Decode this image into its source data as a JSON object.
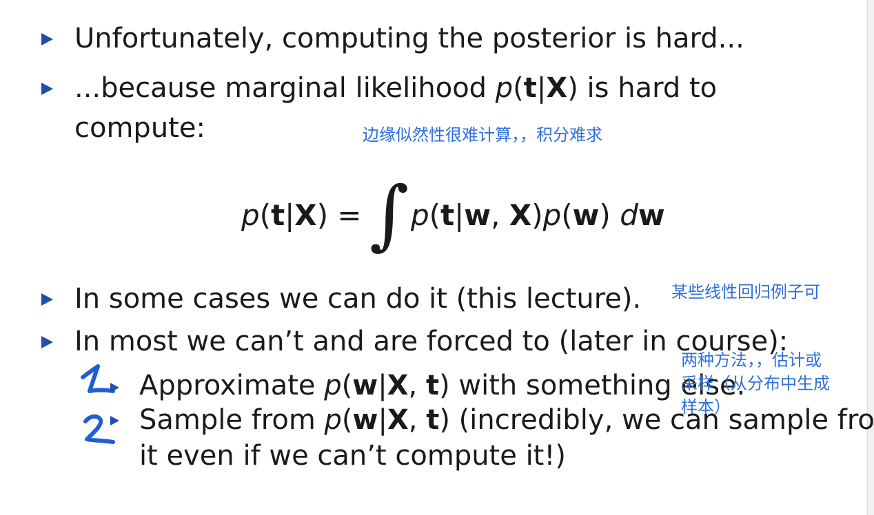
{
  "bullets": {
    "b1": "Unfortunately, computing the posterior is hard...",
    "b2_a": "...because marginal likelihood ",
    "b2_b": " is hard to",
    "b2_c": "compute:",
    "b3": "In some cases we can do it (this lecture).",
    "b4": "In most we can’t and are forced to (later in course):",
    "sub1_a": "Approximate ",
    "sub1_b": " with something else.",
    "sub2_a": "Sample from ",
    "sub2_b": " (incredibly, we can sample from",
    "sub2_c": "it even if we can’t compute it!)"
  },
  "math": {
    "p": "p",
    "t": "t",
    "X": "X",
    "w": "w",
    "d": "d",
    "lparen": "(",
    "rparen": ")",
    "bar": "|",
    "comma": ", ",
    "equals": " = "
  },
  "annotations": {
    "note1": "边缘似然性很难计算，，积分难求",
    "note2": "某些线性回归例子可",
    "note3_l1": "两种方法，，估计或",
    "note3_l2": "采样（从分布中生成",
    "note3_l3": "样本）"
  },
  "colors": {
    "bullet": "#1f4fa8",
    "annotation": "#2f6fdb",
    "handwriting": "#1e5fd6"
  },
  "icons": {
    "bullet": "triangle-bullet-icon",
    "handwritten_1": "handwritten-one-icon",
    "handwritten_2": "handwritten-two-icon"
  }
}
